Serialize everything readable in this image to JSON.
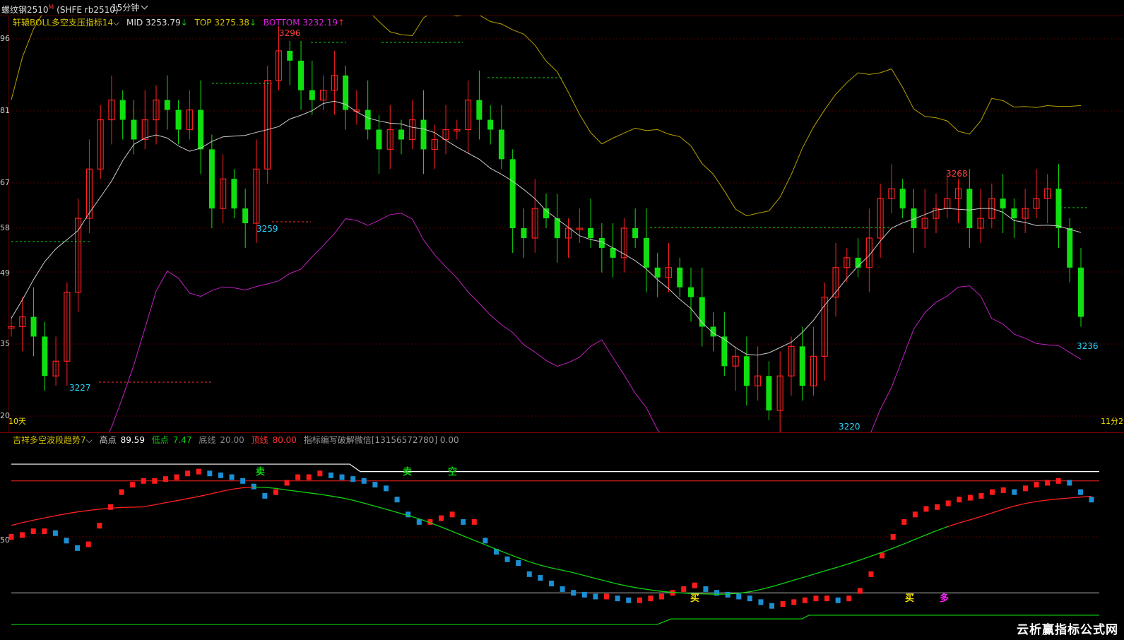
{
  "topbar": {
    "symbol": "螺纹钢2510",
    "symbol_mark": "M",
    "symbol_code": "(SHFE rb2510)",
    "period": "15分钟"
  },
  "main_legend": {
    "name": "轩辕BOLL多空支压指标14",
    "mid": "MID 3253.79",
    "top": "TOP 3275.38",
    "bottom": "BOTTOM 3232.19"
  },
  "main_axis": [
    "96",
    "81",
    "67",
    "58",
    "49",
    "35",
    "20"
  ],
  "main_left_label": "10天",
  "main_right_label": "11分2",
  "peaks": [
    {
      "text": "3296",
      "color": "red"
    },
    {
      "text": "3259",
      "color": "cyan"
    },
    {
      "text": "3227",
      "color": "cyan"
    },
    {
      "text": "3268",
      "color": "red"
    },
    {
      "text": "3236",
      "color": "cyan"
    },
    {
      "text": "3220",
      "color": "cyan"
    }
  ],
  "sub_legend": {
    "name": "吉祥多空波段趋势7",
    "high_label": "高点",
    "high_value": "89.59",
    "low_label": "低点",
    "low_value": "7.47",
    "base_label": "底线",
    "base_value": "20.00",
    "top_label": "顶线",
    "top_value": "80.00",
    "note": "指标编写破解微信[13156572780] 0.00"
  },
  "sub_axis": [
    "50"
  ],
  "signals": [
    {
      "text": "卖",
      "color": "#10d010"
    },
    {
      "text": "卖",
      "color": "#10d010"
    },
    {
      "text": "空",
      "color": "#10d010"
    },
    {
      "text": "买",
      "color": "#f5e300"
    },
    {
      "text": "买",
      "color": "#f5e300"
    },
    {
      "text": "多",
      "color": "#ff20ff"
    }
  ],
  "colors": {
    "bull": "#ff2020",
    "bear": "#10e010",
    "mid_line": "#cccccc",
    "top_line": "#b8a000",
    "bottom_line": "#c020c0",
    "osc_up": "#ff1a1a",
    "osc_down": "#1a8fd4",
    "signal_line": "#ff2020",
    "green_line": "#10d010"
  },
  "watermark": "云析赢指标公式网"
}
